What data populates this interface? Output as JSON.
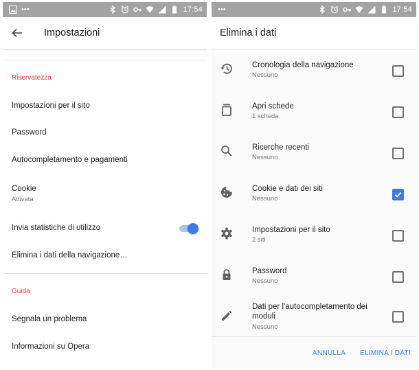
{
  "status_bar": {
    "time": "17:54",
    "dots": "•••"
  },
  "settings": {
    "title": "Impostazioni",
    "sections": [
      {
        "header": "Riservatezza"
      },
      {
        "header": "Guida"
      }
    ],
    "items": [
      {
        "title": "Impostazioni per il sito"
      },
      {
        "title": "Password"
      },
      {
        "title": "Autocompletamento e pagamenti"
      },
      {
        "title": "Cookie",
        "subtitle": "Attivata"
      },
      {
        "title": "Invia statistiche di utilizzo",
        "toggle_on": true
      },
      {
        "title": "Elimina i dati della navigazione…"
      },
      {
        "title": "Segnala un problema"
      },
      {
        "title": "Informazioni su Opera"
      }
    ]
  },
  "clear_data": {
    "title": "Elimina i dati",
    "items": [
      {
        "icon": "history-icon",
        "title": "Cronologia della navigazione",
        "subtitle": "Nessuno",
        "checked": false
      },
      {
        "icon": "tabs-icon",
        "title": "Apri schede",
        "subtitle": "1 scheda",
        "checked": false
      },
      {
        "icon": "search-icon",
        "title": "Ricerche recenti",
        "subtitle": "Nessuno",
        "checked": false
      },
      {
        "icon": "cookie-icon",
        "title": "Cookie e dati dei siti",
        "subtitle": "Nessuno",
        "checked": true
      },
      {
        "icon": "gear-icon",
        "title": "Impostazioni per il sito",
        "subtitle": "2 siti",
        "checked": false
      },
      {
        "icon": "lock-icon",
        "title": "Password",
        "subtitle": "Nessuno",
        "checked": false
      },
      {
        "icon": "pencil-icon",
        "title": "Dati per l'autocompletamento dei",
        "title2": "moduli",
        "subtitle": "Nessuno",
        "checked": false
      }
    ],
    "cancel_label": "ANNULLA",
    "confirm_label": "ELIMINA I DATI"
  },
  "colors": {
    "accent": "#3c7be3",
    "section_header": "#e04040",
    "status_bar": "#a3a3a3"
  }
}
